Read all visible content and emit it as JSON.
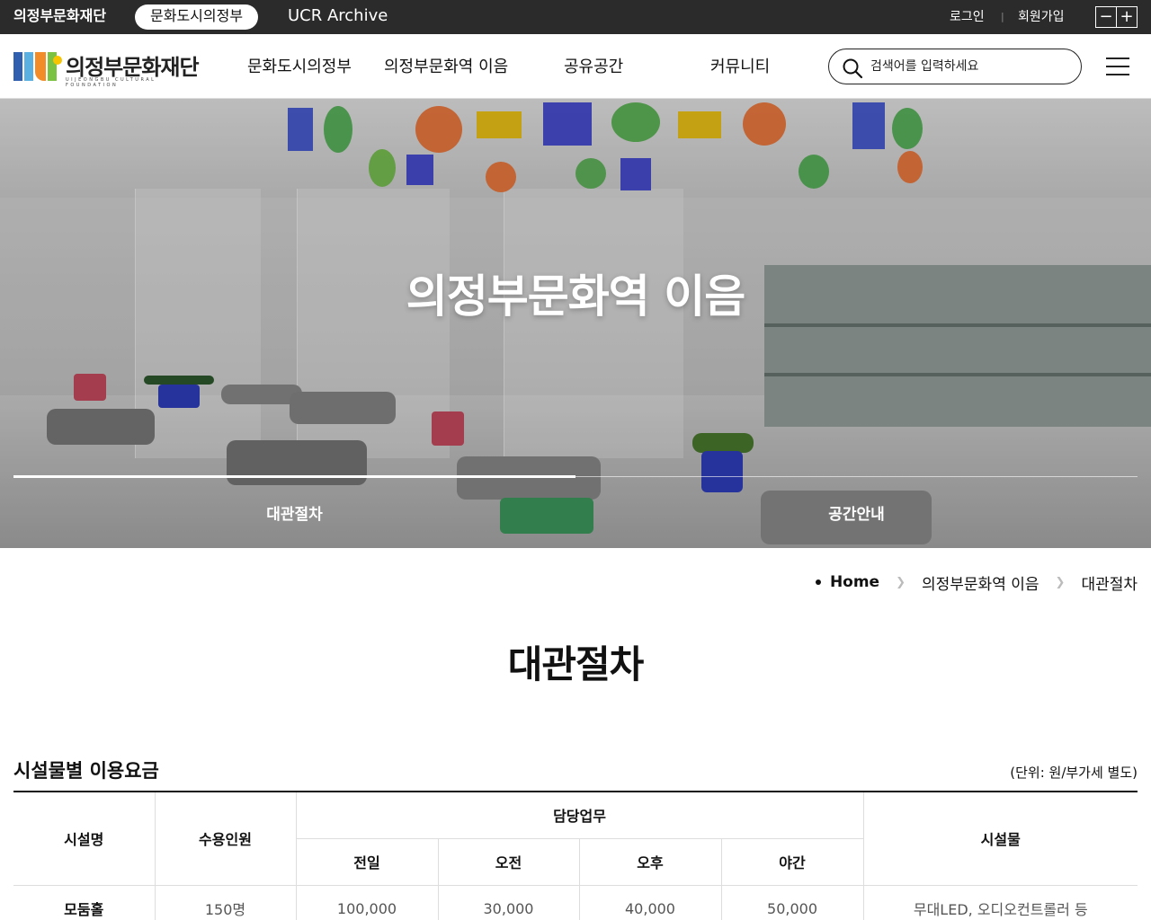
{
  "topbar": {
    "sites": [
      "의정부문화재단",
      "문화도시의정부",
      "UCR Archive"
    ],
    "login": "로그인",
    "separator": "|",
    "join": "회원가입",
    "zoom_out": "−",
    "zoom_in": "+"
  },
  "header": {
    "logo_name": "의정부문화재단",
    "logo_english": "UIJEONGBU CULTURAL FOUNDATION",
    "nav": [
      "문화도시의정부",
      "의정부문화역 이음",
      "공유공간",
      "커뮤니티"
    ],
    "search_placeholder": "검색어를 입력하세요"
  },
  "hero": {
    "title": "의정부문화역 이음",
    "tabs": [
      "대관절차",
      "공간안내"
    ],
    "active_tab": 0
  },
  "breadcrumb": [
    "Home",
    "의정부문화역 이음",
    "대관절차"
  ],
  "page_title": "대관절차",
  "section": {
    "title": "시설물별 이용요금",
    "unit": "(단위: 원/부가세 별도)"
  },
  "table": {
    "headers": {
      "name": "시설명",
      "capacity": "수용인원",
      "group": "담당업무",
      "sub": [
        "전일",
        "오전",
        "오후",
        "야간"
      ],
      "equipment": "시설물"
    },
    "rows": [
      {
        "name": "모둠홀",
        "capacity": "150명",
        "full": "100,000",
        "am": "30,000",
        "pm": "40,000",
        "night": "50,000",
        "equipment": "무대LED, 오디오컨트롤러 등"
      }
    ]
  },
  "colors": {
    "topbar_bg": "#2b2b2b",
    "text": "#111111",
    "logo_blue": "#2f5fae",
    "logo_orange": "#f28c28",
    "logo_green": "#7cc242"
  }
}
